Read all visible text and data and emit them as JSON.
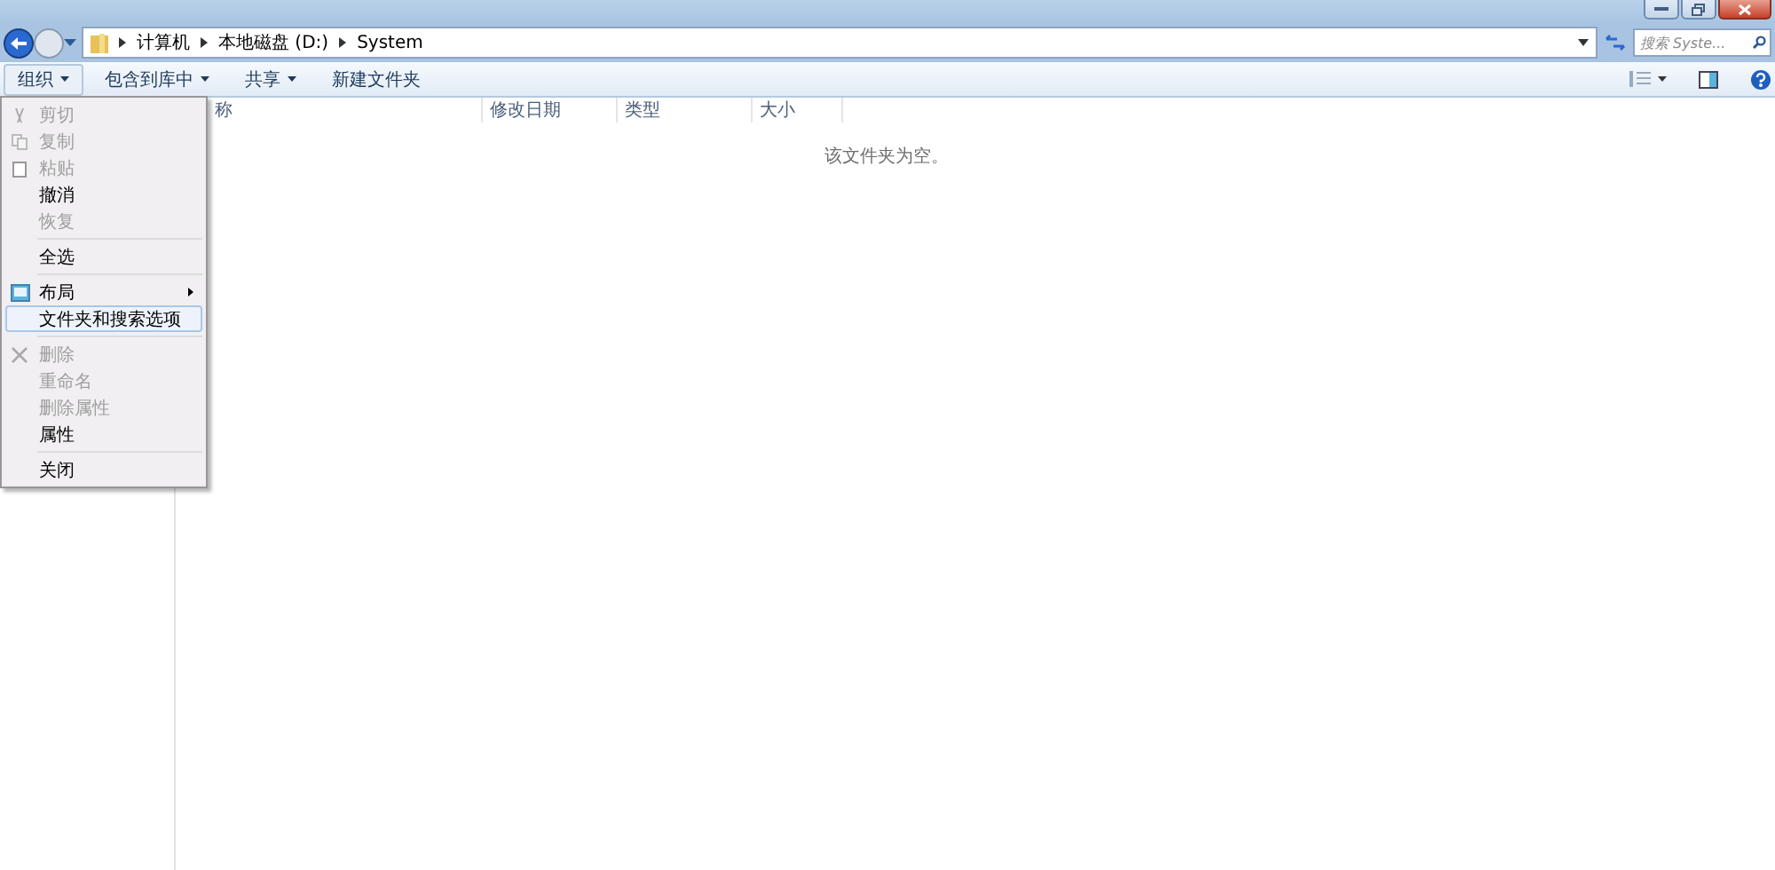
{
  "breadcrumb": [
    "计算机",
    "本地磁盘 (D:)",
    "System"
  ],
  "search": {
    "placeholder": "搜索 Syste..."
  },
  "toolbar": [
    {
      "label": "组织",
      "dropdown": true,
      "selected": true
    },
    {
      "label": "包含到库中",
      "dropdown": true,
      "selected": false
    },
    {
      "label": "共享",
      "dropdown": true,
      "selected": false
    },
    {
      "label": "新建文件夹",
      "dropdown": false,
      "selected": false
    }
  ],
  "columns": [
    "称",
    "修改日期",
    "类型",
    "大小"
  ],
  "empty_message": "该文件夹为空。",
  "menu": [
    {
      "kind": "cut",
      "label": "剪切",
      "disabled": true,
      "selected": false
    },
    {
      "kind": "copy",
      "label": "复制",
      "disabled": true,
      "selected": false
    },
    {
      "kind": "paste",
      "label": "粘贴",
      "disabled": true,
      "selected": false
    },
    {
      "kind": "item",
      "label": "撤消",
      "disabled": false,
      "selected": false
    },
    {
      "kind": "item",
      "label": "恢复",
      "disabled": true,
      "selected": false
    },
    {
      "kind": "separator"
    },
    {
      "kind": "item",
      "label": "全选",
      "disabled": false,
      "selected": false
    },
    {
      "kind": "separator"
    },
    {
      "kind": "layout",
      "label": "布局",
      "submenu": true,
      "disabled": false,
      "selected": false
    },
    {
      "kind": "item",
      "label": "文件夹和搜索选项",
      "disabled": false,
      "selected": true
    },
    {
      "kind": "separator"
    },
    {
      "kind": "delete",
      "label": "删除",
      "disabled": true,
      "selected": false
    },
    {
      "kind": "item",
      "label": "重命名",
      "disabled": true,
      "selected": false
    },
    {
      "kind": "item",
      "label": "删除属性",
      "disabled": true,
      "selected": false
    },
    {
      "kind": "item",
      "label": "属性",
      "disabled": false,
      "selected": false
    },
    {
      "kind": "separator"
    },
    {
      "kind": "item",
      "label": "关闭",
      "disabled": false,
      "selected": false
    }
  ]
}
